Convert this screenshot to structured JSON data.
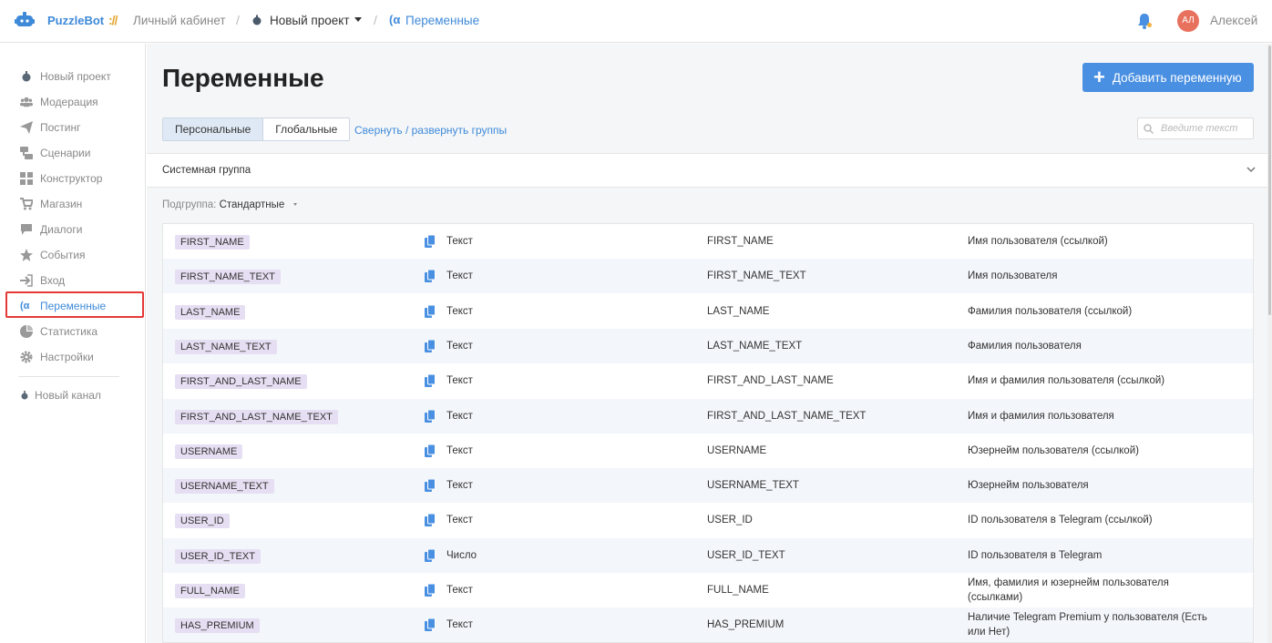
{
  "header": {
    "brand": "PuzzleBot",
    "brand_sep": "://",
    "crumbs": [
      "Личный кабинет",
      "Новый проект",
      "Переменные"
    ],
    "user_initials": "АЛ",
    "user_name": "Алексей",
    "accent": "#3e8ad9"
  },
  "sidebar": {
    "items": [
      {
        "label": "Новый проект",
        "icon": "project-icon"
      },
      {
        "label": "Модерация",
        "icon": "users-icon"
      },
      {
        "label": "Постинг",
        "icon": "send-icon"
      },
      {
        "label": "Сценарии",
        "icon": "scenario-icon"
      },
      {
        "label": "Конструктор",
        "icon": "grid-icon"
      },
      {
        "label": "Магазин",
        "icon": "cart-icon"
      },
      {
        "label": "Диалоги",
        "icon": "chat-icon"
      },
      {
        "label": "События",
        "icon": "star-icon"
      },
      {
        "label": "Вход",
        "icon": "login-icon"
      },
      {
        "label": "Переменные",
        "icon": "variable-icon"
      },
      {
        "label": "Статистика",
        "icon": "pie-icon"
      },
      {
        "label": "Настройки",
        "icon": "gear-icon"
      }
    ],
    "new_channel": "Новый канал"
  },
  "main": {
    "title": "Переменные",
    "add_button": "Добавить переменную",
    "tabs": [
      "Персональные",
      "Глобальные"
    ],
    "collapse_link": "Свернуть / развернуть группы",
    "search_placeholder": "Введите текст",
    "group_title": "Системная группа",
    "subgroup_label": "Подгруппа:",
    "subgroup_value": "Стандартные"
  },
  "rows": [
    {
      "name": "FIRST_NAME",
      "type": "Текст",
      "code": "FIRST_NAME",
      "desc": "Имя пользователя (ссылкой)"
    },
    {
      "name": "FIRST_NAME_TEXT",
      "type": "Текст",
      "code": "FIRST_NAME_TEXT",
      "desc": "Имя пользователя"
    },
    {
      "name": "LAST_NAME",
      "type": "Текст",
      "code": "LAST_NAME",
      "desc": "Фамилия пользователя (ссылкой)"
    },
    {
      "name": "LAST_NAME_TEXT",
      "type": "Текст",
      "code": "LAST_NAME_TEXT",
      "desc": "Фамилия пользователя"
    },
    {
      "name": "FIRST_AND_LAST_NAME",
      "type": "Текст",
      "code": "FIRST_AND_LAST_NAME",
      "desc": "Имя и фамилия пользователя (ссылкой)"
    },
    {
      "name": "FIRST_AND_LAST_NAME_TEXT",
      "type": "Текст",
      "code": "FIRST_AND_LAST_NAME_TEXT",
      "desc": "Имя и фамилия пользователя"
    },
    {
      "name": "USERNAME",
      "type": "Текст",
      "code": "USERNAME",
      "desc": "Юзернейм пользователя (ссылкой)"
    },
    {
      "name": "USERNAME_TEXT",
      "type": "Текст",
      "code": "USERNAME_TEXT",
      "desc": "Юзернейм пользователя"
    },
    {
      "name": "USER_ID",
      "type": "Текст",
      "code": "USER_ID",
      "desc": "ID пользователя в Telegram (ссылкой)"
    },
    {
      "name": "USER_ID_TEXT",
      "type": "Число",
      "code": "USER_ID_TEXT",
      "desc": "ID пользователя в Telegram"
    },
    {
      "name": "FULL_NAME",
      "type": "Текст",
      "code": "FULL_NAME",
      "desc": "Имя, фамилия и юзернейм пользователя (ссылками)"
    },
    {
      "name": "HAS_PREMIUM",
      "type": "Текст",
      "code": "HAS_PREMIUM",
      "desc": "Наличие Telegram Premium у пользователя (Есть или Нет)"
    }
  ]
}
